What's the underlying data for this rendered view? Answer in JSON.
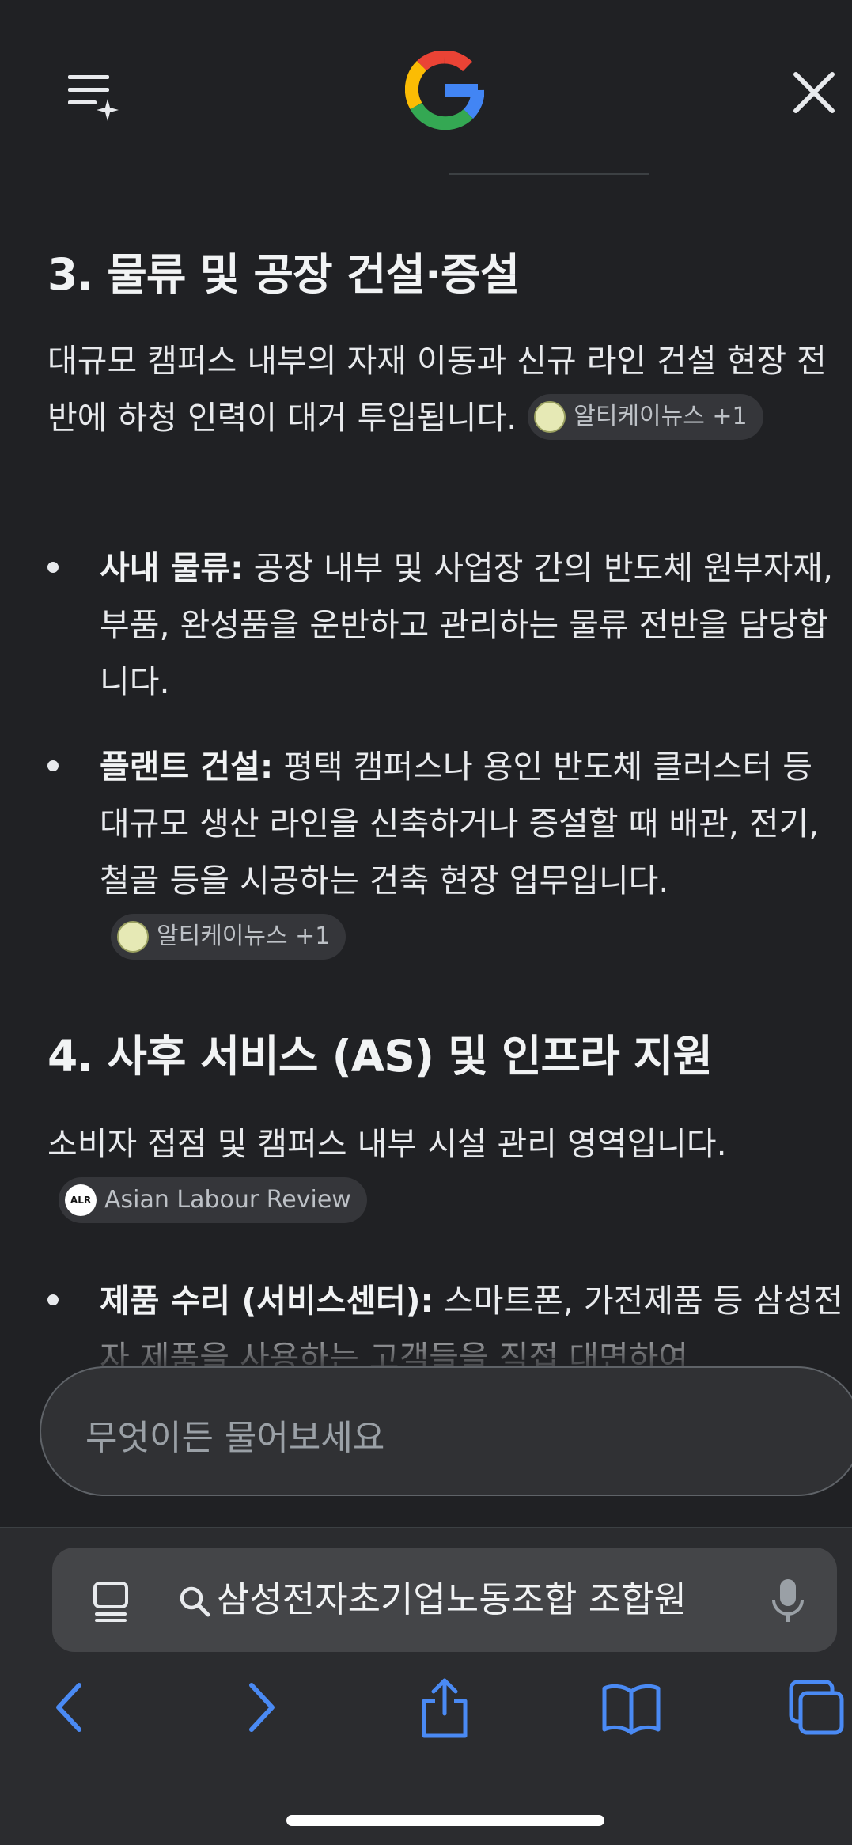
{
  "header": {
    "menu_icon": "menu-sparkle-icon",
    "logo": "google-g-logo",
    "close_icon": "close-icon"
  },
  "section3": {
    "heading": "3. 물류 및 공장 건설·증설",
    "intro": "대규모 캠퍼스 내부의 자재 이동과 신규 라인 건설 현장 전반에 하청 인력이 대거 투입됩니다.",
    "intro_chip": "알티케이뉴스 +1",
    "bullets": [
      {
        "term": "사내 물류:",
        "text": " 공장 내부 및 사업장 간의 반도체 원부자재, 부품, 완성품을 운반하고 관리하는 물류 전반을 담당합니다."
      },
      {
        "term": "플랜트 건설:",
        "text": " 평택 캠퍼스나 용인 반도체 클러스터 등 대규모 생산 라인을 신축하거나 증설할 때 배관, 전기, 철골 등을 시공하는 건축 현장 업무입니다.",
        "chip": "알티케이뉴스 +1"
      }
    ]
  },
  "section4": {
    "heading": "4. 사후 서비스 (AS) 및 인프라 지원",
    "intro": "소비자 접점 및 캠퍼스 내부 시설 관리 영역입니다.",
    "intro_chip": "Asian Labour Review",
    "bullets": [
      {
        "term": "제품 수리 (서비스센터):",
        "text": " 스마트폰, 가전제품 등 삼성전자 제품을 사용하는 고객들을 직접 대면하여"
      }
    ]
  },
  "ask": {
    "placeholder": "무엇이든 물어보세요"
  },
  "browser": {
    "url_text": "삼성전자초기업노동조합 조합원",
    "nav_icons": [
      "back-icon",
      "forward-icon",
      "share-icon",
      "bookmarks-icon",
      "tabs-icon"
    ]
  },
  "colors": {
    "background": "#202124",
    "accent": "#4a8af4",
    "chip_bg": "#35363a"
  }
}
